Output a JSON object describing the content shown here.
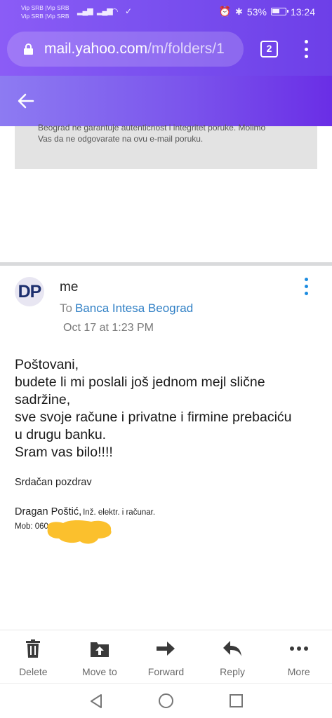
{
  "status_bar": {
    "carrier_line1": "Vip SRB |Vip SRB",
    "carrier_line2": "Vip SRB |Vip SRB",
    "battery": "53%",
    "time": "13:24"
  },
  "browser": {
    "url_domain": "mail.yahoo.com",
    "url_path": "/m/folders/1",
    "tab_count": "2"
  },
  "previous_message": {
    "lines": [
      "Beograd ne garantuje autenticnost i integritet poruke. Molimo",
      "Vas da ne odgovarate na ovu e-mail poruku."
    ]
  },
  "message": {
    "avatar_initials": "DP",
    "from": "me",
    "to_label": "To",
    "to_recipient": "Banca Intesa Beograd",
    "date": "Oct 17 at 1:23 PM",
    "body_lines": [
      "Poštovani,",
      "budete li mi poslali još jednom  mejl slične",
      "sadržine,",
      "sve svoje račune i privatne i firmine prebaciću",
      "u drugu banku.",
      "Sram vas bilo!!!!"
    ],
    "regards": "Srdačan pozdrav",
    "signature_name": "Dragan Poštić,",
    "signature_title": "Inž. elektr. i računar.",
    "mobile": "Mob: 060"
  },
  "toolbar": {
    "delete": "Delete",
    "move_to": "Move to",
    "forward": "Forward",
    "reply": "Reply",
    "more": "More"
  },
  "colors": {
    "header_gradient_start": "#8b5cf6",
    "header_gradient_end": "#6a2ee6",
    "link_blue": "#2f7fc5",
    "kebab_blue": "#1d8ce0",
    "redaction_yellow": "#fbc02d"
  }
}
